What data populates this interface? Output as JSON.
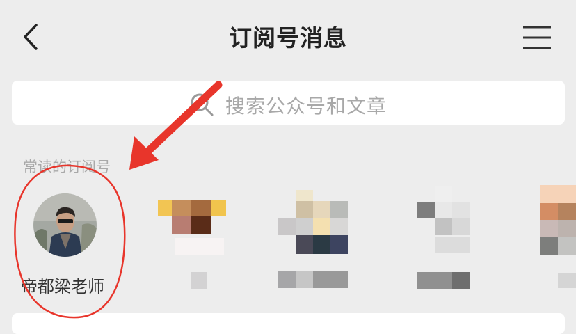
{
  "header": {
    "title": "订阅号消息",
    "back_icon": "chevron-left-icon",
    "menu_icon": "hamburger-menu-icon"
  },
  "search": {
    "placeholder": "搜索公众号和文章",
    "icon": "search-icon"
  },
  "frequent": {
    "label": "常读的订阅号",
    "accounts": [
      {
        "name": "帝都梁老师"
      }
    ]
  },
  "annotation": {
    "arrow_color": "#e8352b",
    "circle_color": "#e8352b"
  }
}
